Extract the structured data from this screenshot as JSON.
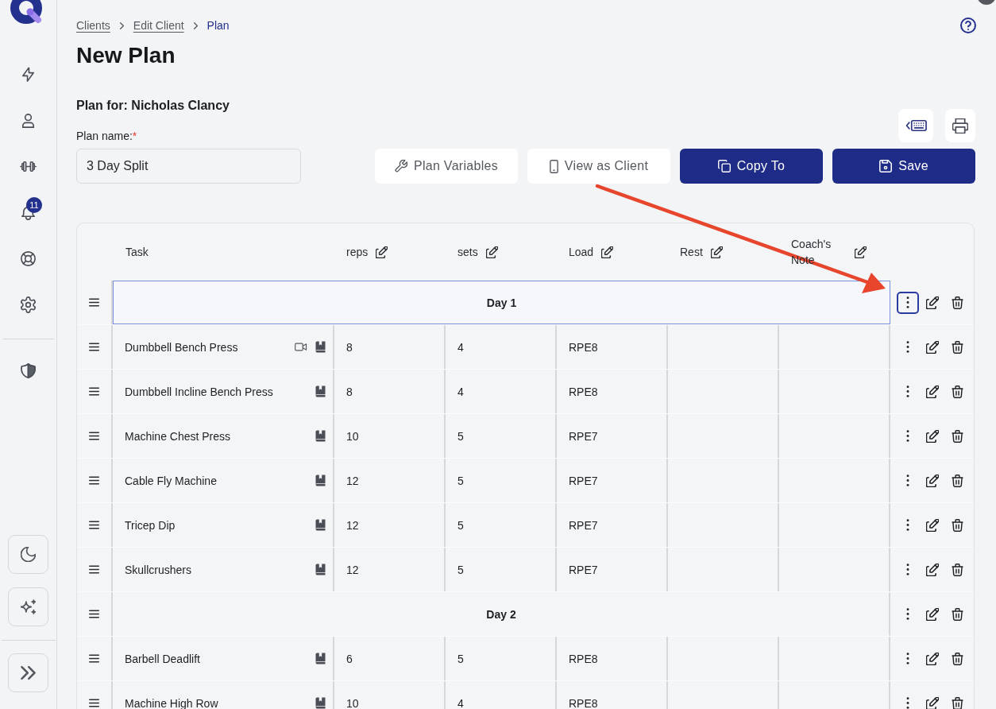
{
  "sidebar": {
    "notification_badge": "11"
  },
  "breadcrumb": [
    {
      "label": "Clients",
      "current": false
    },
    {
      "label": "Edit Client",
      "current": false
    },
    {
      "label": "Plan",
      "current": true
    }
  ],
  "title": "New Plan",
  "plan_for": "Plan for: Nicholas Clancy",
  "plan_name": {
    "label": "Plan name:",
    "required_mark": "*",
    "value": "3 Day Split"
  },
  "actions": [
    {
      "label": "Plan Variables",
      "kind": "secondary"
    },
    {
      "label": "View as Client",
      "kind": "secondary"
    },
    {
      "label": "Copy To",
      "kind": "primary"
    },
    {
      "label": "Save",
      "kind": "primary"
    }
  ],
  "table": {
    "columns": [
      {
        "label": "Task",
        "editable": false
      },
      {
        "label": "reps",
        "editable": true
      },
      {
        "label": "sets",
        "editable": true
      },
      {
        "label": "Load",
        "editable": true
      },
      {
        "label": "Rest",
        "editable": true
      },
      {
        "label": "Coach's Note",
        "editable": true
      }
    ],
    "rows": [
      {
        "kind": "day",
        "label": "Day 1",
        "selected": true
      },
      {
        "kind": "exercise",
        "task": "Dumbbell Bench Press",
        "video": true,
        "values": [
          "8",
          "4",
          "RPE8"
        ],
        "selected": false
      },
      {
        "kind": "exercise",
        "task": "Dumbbell Incline Bench Press",
        "video": false,
        "values": [
          "8",
          "4",
          "RPE8"
        ],
        "selected": false
      },
      {
        "kind": "exercise",
        "task": "Machine Chest Press",
        "video": false,
        "values": [
          "10",
          "5",
          "RPE7"
        ],
        "selected": false
      },
      {
        "kind": "exercise",
        "task": "Cable Fly Machine",
        "video": false,
        "values": [
          "12",
          "5",
          "RPE7"
        ],
        "selected": false
      },
      {
        "kind": "exercise",
        "task": "Tricep Dip",
        "video": false,
        "values": [
          "12",
          "5",
          "RPE7"
        ],
        "selected": false
      },
      {
        "kind": "exercise",
        "task": "Skullcrushers",
        "video": false,
        "values": [
          "12",
          "5",
          "RPE7"
        ],
        "selected": false
      },
      {
        "kind": "day",
        "label": "Day 2",
        "selected": false
      },
      {
        "kind": "exercise",
        "task": "Barbell Deadlift",
        "video": false,
        "values": [
          "6",
          "5",
          "RPE8"
        ],
        "selected": false
      },
      {
        "kind": "exercise",
        "task": "Machine High Row",
        "video": false,
        "values": [
          "10",
          "4",
          "RPE8"
        ],
        "selected": false
      }
    ]
  }
}
